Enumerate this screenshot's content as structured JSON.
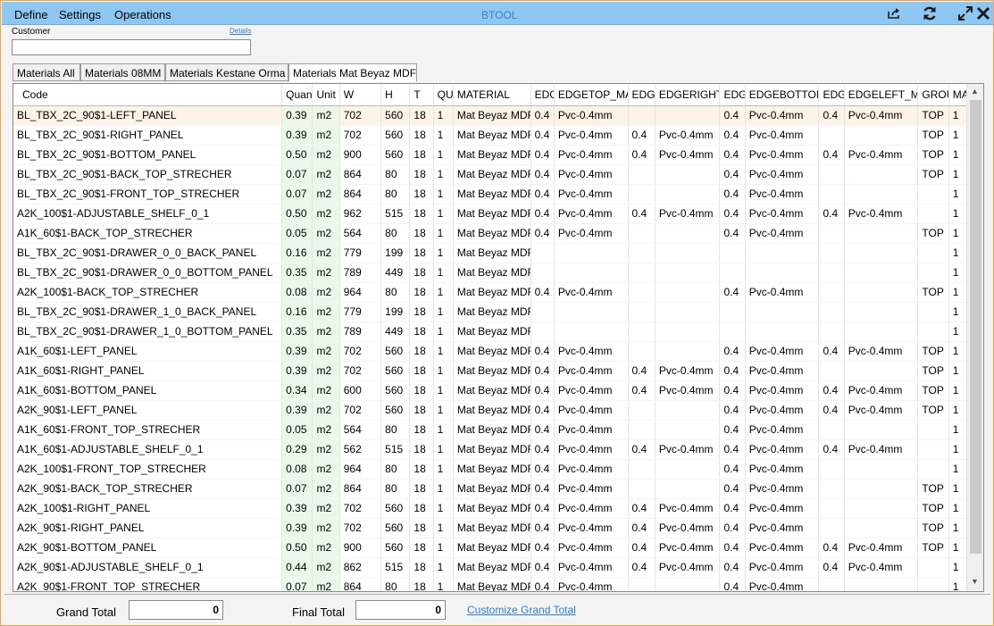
{
  "menu": {
    "define": "Define",
    "settings": "Settings",
    "operations": "Operations"
  },
  "app_title": "BTOOL",
  "customer": {
    "label": "Customer",
    "details_link": "Details",
    "value": ""
  },
  "tabs": [
    "Materials All",
    "Materials 08MM",
    "Materials Kestane Orma",
    "Materials Mat Beyaz MDF"
  ],
  "active_tab": 3,
  "columns": [
    "Code",
    "Quan",
    "Unit",
    "W",
    "H",
    "T",
    "QU",
    "MATERIAL",
    "EDG",
    "EDGETOP_MA",
    "EDG",
    "EDGERIGHT",
    "EDG",
    "EDGEBOTTOM",
    "EDG",
    "EDGELEFT_MA",
    "GROU",
    "MA"
  ],
  "rows": [
    [
      "BL_TBX_2C_90$1-LEFT_PANEL",
      "0.39",
      "m2",
      "702",
      "560",
      "18",
      "1",
      "Mat Beyaz MDF",
      "0.4",
      "Pvc-0.4mm",
      "",
      "",
      "0.4",
      "Pvc-0.4mm",
      "0.4",
      "Pvc-0.4mm",
      "TOP",
      "1"
    ],
    [
      "BL_TBX_2C_90$1-RIGHT_PANEL",
      "0.39",
      "m2",
      "702",
      "560",
      "18",
      "1",
      "Mat Beyaz MDF",
      "0.4",
      "Pvc-0.4mm",
      "0.4",
      "Pvc-0.4mm",
      "0.4",
      "Pvc-0.4mm",
      "",
      "",
      "TOP",
      "1"
    ],
    [
      "BL_TBX_2C_90$1-BOTTOM_PANEL",
      "0.50",
      "m2",
      "900",
      "560",
      "18",
      "1",
      "Mat Beyaz MDF",
      "0.4",
      "Pvc-0.4mm",
      "0.4",
      "Pvc-0.4mm",
      "0.4",
      "Pvc-0.4mm",
      "0.4",
      "Pvc-0.4mm",
      "TOP",
      "1"
    ],
    [
      "BL_TBX_2C_90$1-BACK_TOP_STRECHER",
      "0.07",
      "m2",
      "864",
      "80",
      "18",
      "1",
      "Mat Beyaz MDF",
      "0.4",
      "Pvc-0.4mm",
      "",
      "",
      "0.4",
      "Pvc-0.4mm",
      "",
      "",
      "TOP",
      "1"
    ],
    [
      "BL_TBX_2C_90$1-FRONT_TOP_STRECHER",
      "0.07",
      "m2",
      "864",
      "80",
      "18",
      "1",
      "Mat Beyaz MDF",
      "0.4",
      "Pvc-0.4mm",
      "",
      "",
      "0.4",
      "Pvc-0.4mm",
      "",
      "",
      "",
      "1"
    ],
    [
      "A2K_100$1-ADJUSTABLE_SHELF_0_1",
      "0.50",
      "m2",
      "962",
      "515",
      "18",
      "1",
      "Mat Beyaz MDF",
      "0.4",
      "Pvc-0.4mm",
      "0.4",
      "Pvc-0.4mm",
      "0.4",
      "Pvc-0.4mm",
      "0.4",
      "Pvc-0.4mm",
      "",
      "1"
    ],
    [
      "A1K_60$1-BACK_TOP_STRECHER",
      "0.05",
      "m2",
      "564",
      "80",
      "18",
      "1",
      "Mat Beyaz MDF",
      "0.4",
      "Pvc-0.4mm",
      "",
      "",
      "0.4",
      "Pvc-0.4mm",
      "",
      "",
      "TOP",
      "1"
    ],
    [
      "BL_TBX_2C_90$1-DRAWER_0_0_BACK_PANEL",
      "0.16",
      "m2",
      "779",
      "199",
      "18",
      "1",
      "Mat Beyaz MDF",
      "",
      "",
      "",
      "",
      "",
      "",
      "",
      "",
      "",
      "1"
    ],
    [
      "BL_TBX_2C_90$1-DRAWER_0_0_BOTTOM_PANEL",
      "0.35",
      "m2",
      "789",
      "449",
      "18",
      "1",
      "Mat Beyaz MDF",
      "",
      "",
      "",
      "",
      "",
      "",
      "",
      "",
      "",
      "1"
    ],
    [
      "A2K_100$1-BACK_TOP_STRECHER",
      "0.08",
      "m2",
      "964",
      "80",
      "18",
      "1",
      "Mat Beyaz MDF",
      "0.4",
      "Pvc-0.4mm",
      "",
      "",
      "0.4",
      "Pvc-0.4mm",
      "",
      "",
      "TOP",
      "1"
    ],
    [
      "BL_TBX_2C_90$1-DRAWER_1_0_BACK_PANEL",
      "0.16",
      "m2",
      "779",
      "199",
      "18",
      "1",
      "Mat Beyaz MDF",
      "",
      "",
      "",
      "",
      "",
      "",
      "",
      "",
      "",
      "1"
    ],
    [
      "BL_TBX_2C_90$1-DRAWER_1_0_BOTTOM_PANEL",
      "0.35",
      "m2",
      "789",
      "449",
      "18",
      "1",
      "Mat Beyaz MDF",
      "",
      "",
      "",
      "",
      "",
      "",
      "",
      "",
      "",
      "1"
    ],
    [
      "A1K_60$1-LEFT_PANEL",
      "0.39",
      "m2",
      "702",
      "560",
      "18",
      "1",
      "Mat Beyaz MDF",
      "0.4",
      "Pvc-0.4mm",
      "",
      "",
      "0.4",
      "Pvc-0.4mm",
      "0.4",
      "Pvc-0.4mm",
      "TOP",
      "1"
    ],
    [
      "A1K_60$1-RIGHT_PANEL",
      "0.39",
      "m2",
      "702",
      "560",
      "18",
      "1",
      "Mat Beyaz MDF",
      "0.4",
      "Pvc-0.4mm",
      "0.4",
      "Pvc-0.4mm",
      "0.4",
      "Pvc-0.4mm",
      "",
      "",
      "TOP",
      "1"
    ],
    [
      "A1K_60$1-BOTTOM_PANEL",
      "0.34",
      "m2",
      "600",
      "560",
      "18",
      "1",
      "Mat Beyaz MDF",
      "0.4",
      "Pvc-0.4mm",
      "0.4",
      "Pvc-0.4mm",
      "0.4",
      "Pvc-0.4mm",
      "0.4",
      "Pvc-0.4mm",
      "TOP",
      "1"
    ],
    [
      "A2K_90$1-LEFT_PANEL",
      "0.39",
      "m2",
      "702",
      "560",
      "18",
      "1",
      "Mat Beyaz MDF",
      "0.4",
      "Pvc-0.4mm",
      "",
      "",
      "0.4",
      "Pvc-0.4mm",
      "0.4",
      "Pvc-0.4mm",
      "TOP",
      "1"
    ],
    [
      "A1K_60$1-FRONT_TOP_STRECHER",
      "0.05",
      "m2",
      "564",
      "80",
      "18",
      "1",
      "Mat Beyaz MDF",
      "0.4",
      "Pvc-0.4mm",
      "",
      "",
      "0.4",
      "Pvc-0.4mm",
      "",
      "",
      "",
      "1"
    ],
    [
      "A1K_60$1-ADJUSTABLE_SHELF_0_1",
      "0.29",
      "m2",
      "562",
      "515",
      "18",
      "1",
      "Mat Beyaz MDF",
      "0.4",
      "Pvc-0.4mm",
      "0.4",
      "Pvc-0.4mm",
      "0.4",
      "Pvc-0.4mm",
      "0.4",
      "Pvc-0.4mm",
      "",
      "1"
    ],
    [
      "A2K_100$1-FRONT_TOP_STRECHER",
      "0.08",
      "m2",
      "964",
      "80",
      "18",
      "1",
      "Mat Beyaz MDF",
      "0.4",
      "Pvc-0.4mm",
      "",
      "",
      "0.4",
      "Pvc-0.4mm",
      "",
      "",
      "",
      "1"
    ],
    [
      "A2K_90$1-BACK_TOP_STRECHER",
      "0.07",
      "m2",
      "864",
      "80",
      "18",
      "1",
      "Mat Beyaz MDF",
      "0.4",
      "Pvc-0.4mm",
      "",
      "",
      "0.4",
      "Pvc-0.4mm",
      "",
      "",
      "TOP",
      "1"
    ],
    [
      "A2K_100$1-RIGHT_PANEL",
      "0.39",
      "m2",
      "702",
      "560",
      "18",
      "1",
      "Mat Beyaz MDF",
      "0.4",
      "Pvc-0.4mm",
      "0.4",
      "Pvc-0.4mm",
      "0.4",
      "Pvc-0.4mm",
      "",
      "",
      "TOP",
      "1"
    ],
    [
      "A2K_90$1-RIGHT_PANEL",
      "0.39",
      "m2",
      "702",
      "560",
      "18",
      "1",
      "Mat Beyaz MDF",
      "0.4",
      "Pvc-0.4mm",
      "0.4",
      "Pvc-0.4mm",
      "0.4",
      "Pvc-0.4mm",
      "",
      "",
      "TOP",
      "1"
    ],
    [
      "A2K_90$1-BOTTOM_PANEL",
      "0.50",
      "m2",
      "900",
      "560",
      "18",
      "1",
      "Mat Beyaz MDF",
      "0.4",
      "Pvc-0.4mm",
      "0.4",
      "Pvc-0.4mm",
      "0.4",
      "Pvc-0.4mm",
      "0.4",
      "Pvc-0.4mm",
      "TOP",
      "1"
    ],
    [
      "A2K_90$1-ADJUSTABLE_SHELF_0_1",
      "0.44",
      "m2",
      "862",
      "515",
      "18",
      "1",
      "Mat Beyaz MDF",
      "0.4",
      "Pvc-0.4mm",
      "0.4",
      "Pvc-0.4mm",
      "0.4",
      "Pvc-0.4mm",
      "0.4",
      "Pvc-0.4mm",
      "",
      "1"
    ],
    [
      "A2K_90$1-FRONT_TOP_STRECHER",
      "0.07",
      "m2",
      "864",
      "80",
      "18",
      "1",
      "Mat Beyaz MDF",
      "0.4",
      "Pvc-0.4mm",
      "",
      "",
      "0.4",
      "Pvc-0.4mm",
      "",
      "",
      "",
      "1"
    ]
  ],
  "selected_row": 0,
  "footer": {
    "grand_total_label": "Grand Total",
    "grand_total_value": "0",
    "final_total_label": "Final Total",
    "final_total_value": "0",
    "customize_link": "Customize Grand Total"
  },
  "icons": {
    "share": "share-icon",
    "refresh": "refresh-icon",
    "expand": "expand-icon",
    "close": "close-icon"
  },
  "colors": {
    "titlebar": "#8ec7f2",
    "app_title": "#3b7fc4",
    "link": "#2b7fd1",
    "qty_column": "#eaf8ea",
    "selected_row": "#fdf3e6",
    "frame": "#e6a84a"
  }
}
